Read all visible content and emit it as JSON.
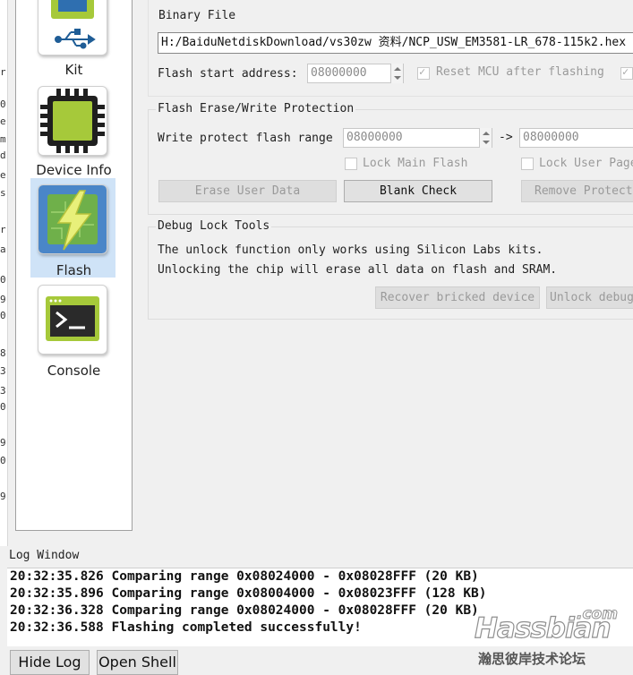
{
  "sidebar": {
    "items": [
      {
        "label": "Kit",
        "icon": "usb-board-icon"
      },
      {
        "label": "Device Info",
        "icon": "chip-icon"
      },
      {
        "label": "Flash",
        "icon": "flash-chip-icon",
        "selected": true
      },
      {
        "label": "Console",
        "icon": "terminal-icon"
      }
    ]
  },
  "left_strip_chars": [
    "r",
    "0",
    "e",
    "m",
    "d",
    "e",
    "s",
    "r",
    "a",
    "0",
    "9",
    "0",
    "8",
    "3",
    "3",
    "0",
    "9",
    "0",
    "9"
  ],
  "flash": {
    "binary_file_label": "Binary File",
    "binary_file_value": "H:/BaiduNetdiskDownload/vs30zw 资料/NCP_USW_EM3581-LR_678-115k2.hex",
    "start_address_label": "Flash start address:",
    "start_address_value": "08000000",
    "reset_mcu_label": "Reset MCU after flashing"
  },
  "protection": {
    "title": "Flash Erase/Write Protection",
    "range_label": "Write protect flash range",
    "range_from": "08000000",
    "arrow": "->",
    "range_to": "08000000",
    "lock_main_label": "Lock Main Flash",
    "lock_user_label": "Lock User Page",
    "erase_user_data": "Erase User Data",
    "blank_check": "Blank Check",
    "remove_protection": "Remove Protection"
  },
  "debug_lock": {
    "title": "Debug Lock Tools",
    "line1": "The unlock function only works using Silicon Labs kits.",
    "line2": "Unlocking the chip will erase all data on flash and SRAM.",
    "recover_button": "Recover bricked device",
    "unlock_button": "Unlock debug"
  },
  "log": {
    "title": "Log Window",
    "lines": [
      "20:32:35.826 Comparing range 0x08024000 - 0x08028FFF (20 KB)",
      "20:32:35.896 Comparing range 0x08004000 - 0x08023FFF (128 KB)",
      "20:32:36.328 Comparing range 0x08024000 - 0x08028FFF (20 KB)",
      "20:32:36.588 Flashing completed successfully!"
    ]
  },
  "bottom": {
    "hide_log": "Hide Log",
    "open_shell": "Open Shell"
  },
  "watermark": {
    "brand": "Hassbian",
    "tld": ".com",
    "subtitle": "瀚思彼岸技术论坛"
  },
  "colors": {
    "selection": "#cfe3f7",
    "chip_green": "#a6c93a",
    "chip_blue": "#2f6fb0"
  }
}
